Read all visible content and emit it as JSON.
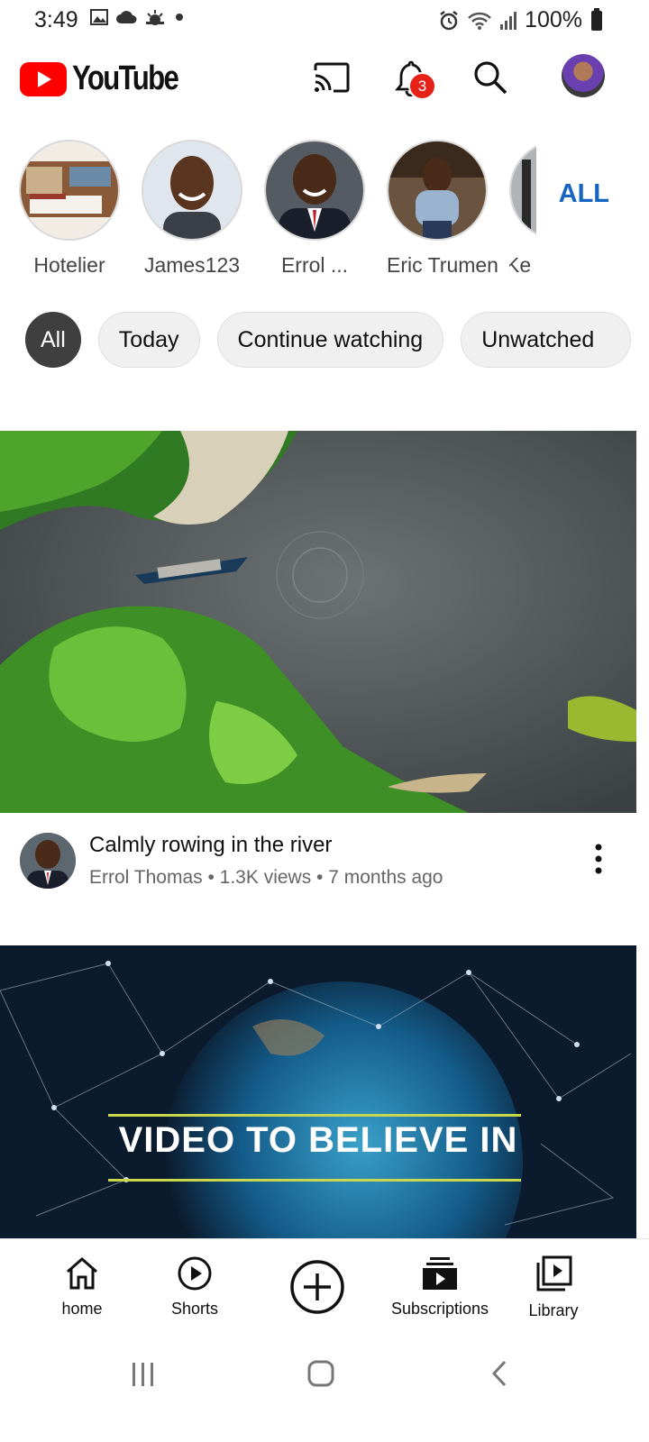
{
  "status_bar": {
    "time": "3:49",
    "battery": "100%"
  },
  "header": {
    "app_name": "YouTube",
    "notification_count": "3"
  },
  "channels": [
    {
      "name": "Hotelier"
    },
    {
      "name": "James123"
    },
    {
      "name": "Errol ..."
    },
    {
      "name": "Eric Trumen"
    },
    {
      "name": "Ke"
    }
  ],
  "channels_all_label": "ALL",
  "chips": [
    {
      "label": "All"
    },
    {
      "label": "Today"
    },
    {
      "label": "Continue watching"
    },
    {
      "label": "Unwatched"
    }
  ],
  "videos": [
    {
      "title": "Calmly rowing in the river",
      "subtitle": "Errol Thomas • 1.3K views • 7 months ago"
    },
    {
      "thumbnail_text": "VIDEO TO BELIEVE IN"
    }
  ],
  "bottom_nav": [
    {
      "label": "home"
    },
    {
      "label": "Shorts"
    },
    {
      "label": ""
    },
    {
      "label": "Subscriptions"
    },
    {
      "label": "Library"
    }
  ],
  "colors": {
    "brand_red": "#ff0000",
    "badge_red": "#e62117",
    "all_link_blue": "#1565c0",
    "chip_active": "#3f3f3f"
  }
}
